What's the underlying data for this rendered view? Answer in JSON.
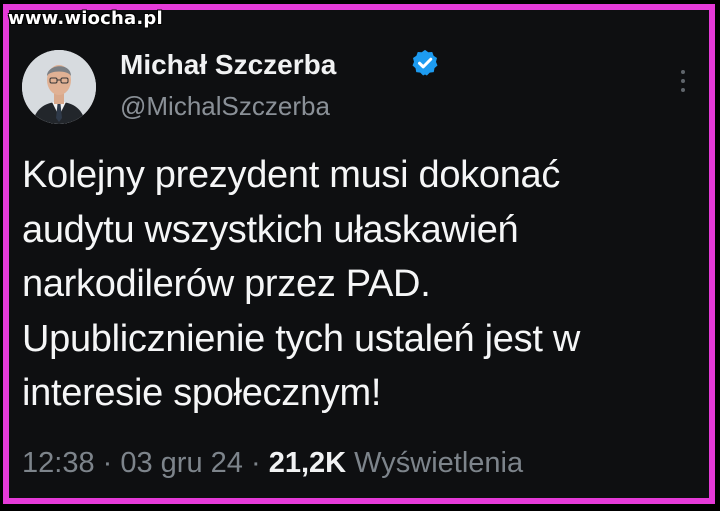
{
  "watermark": "www.wiocha.pl",
  "author": {
    "name": "Michał Szczerba",
    "handle": "@MichalSzczerba",
    "verified_color": "#1d9bf0"
  },
  "tweet": {
    "lines": [
      "Kolejny prezydent musi dokonać",
      "audytu wszystkich ułaskawień",
      "narkodilerów przez PAD.",
      "Upublicznienie tych ustaleń jest w",
      "interesie społecznym!"
    ]
  },
  "meta": {
    "time": "12:38",
    "sep1": " · ",
    "date": "03 gru 24",
    "sep2": " · ",
    "views_count": "21,2K",
    "views_label": " Wyświetlenia"
  },
  "colors": {
    "border": "#e53ad8",
    "background": "#0e0f11",
    "text": "#f5f6f7",
    "muted": "#7d848b"
  },
  "icons": {
    "verified": "verified-badge-icon",
    "more": "more-options-icon"
  }
}
